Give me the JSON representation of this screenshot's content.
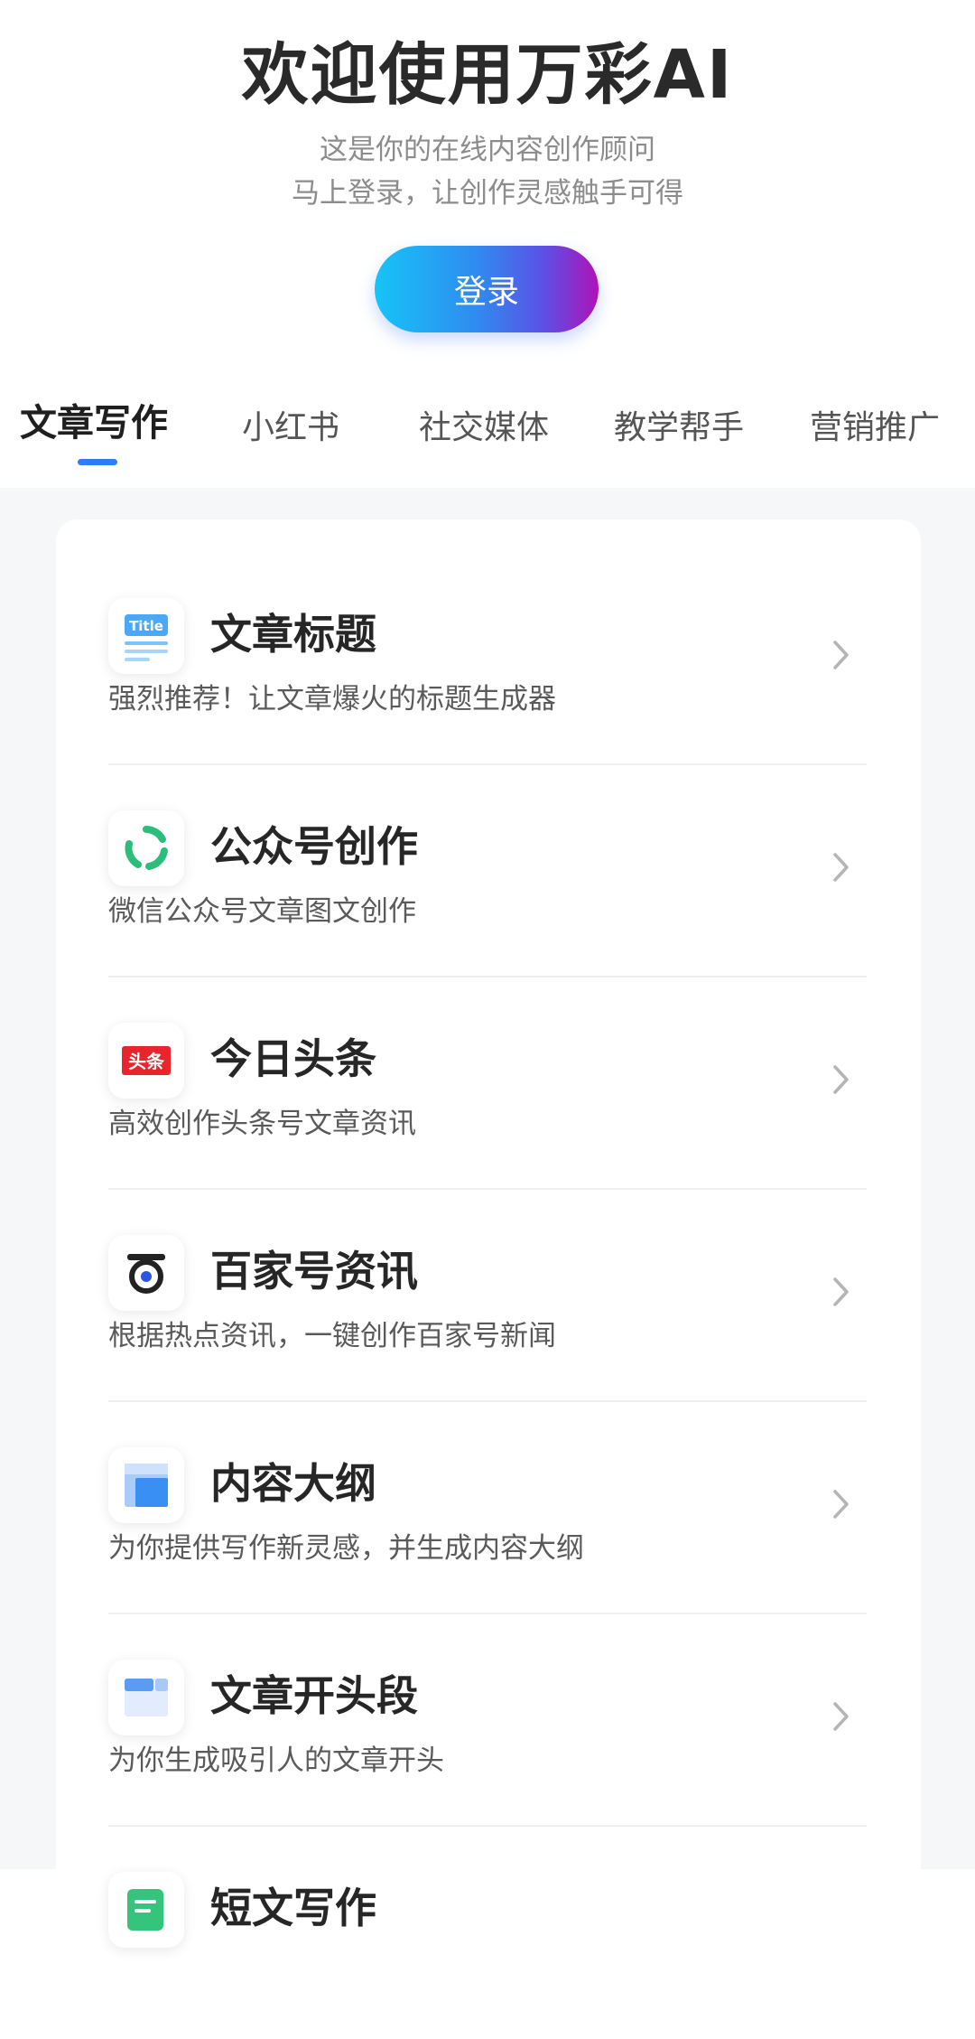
{
  "hero": {
    "title": "欢迎使用万彩AI",
    "subtitle_line1": "这是你的在线内容创作顾问",
    "subtitle_line2": "马上登录，让创作灵感触手可得",
    "login_label": "登录"
  },
  "tabs": [
    {
      "label": "文章写作",
      "active": true
    },
    {
      "label": "小红书",
      "active": false
    },
    {
      "label": "社交媒体",
      "active": false
    },
    {
      "label": "教学帮手",
      "active": false
    },
    {
      "label": "营销推广",
      "active": false
    }
  ],
  "colors": {
    "accent": "#2f7cf6",
    "button_gradient": [
      "#16c4f7",
      "#2f8cf0",
      "#5a52e6",
      "#b012b8"
    ],
    "background": "#f6f7f9"
  },
  "items": [
    {
      "title": "文章标题",
      "desc": "强烈推荐！让文章爆火的标题生成器",
      "icon": "title-doc-icon",
      "icon_text": "Title"
    },
    {
      "title": "公众号创作",
      "desc": "微信公众号文章图文创作",
      "icon": "wechat-official-account-icon"
    },
    {
      "title": "今日头条",
      "desc": "高效创作头条号文章资讯",
      "icon": "toutiao-icon",
      "icon_text": "头条"
    },
    {
      "title": "百家号资讯",
      "desc": "根据热点资讯，一键创作百家号新闻",
      "icon": "baijiahao-icon"
    },
    {
      "title": "内容大纲",
      "desc": "为你提供写作新灵感，并生成内容大纲",
      "icon": "outline-icon"
    },
    {
      "title": "文章开头段",
      "desc": "为你生成吸引人的文章开头",
      "icon": "opening-paragraph-icon"
    },
    {
      "title": "短文写作",
      "desc": "",
      "icon": "short-text-icon"
    }
  ]
}
